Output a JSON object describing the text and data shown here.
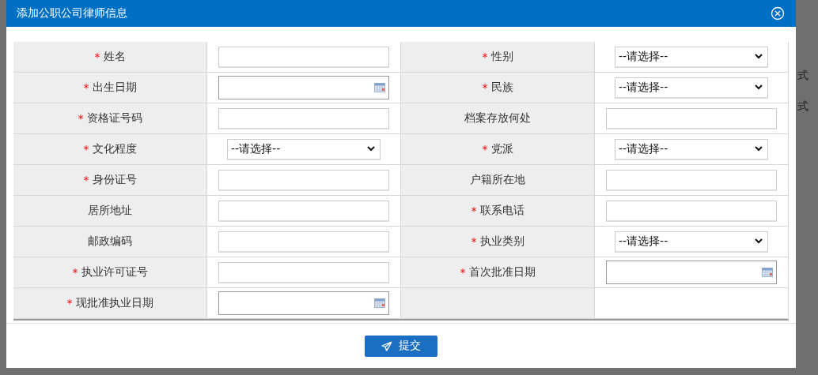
{
  "dialog": {
    "title": "添加公职公司律师信息",
    "submit": "提交"
  },
  "background_cells": [
    "式",
    "式"
  ],
  "rows": [
    [
      {
        "mark": "*",
        "label": "姓名",
        "field": {
          "kind": "text"
        }
      },
      {
        "mark": "*",
        "label": "性别",
        "field": {
          "kind": "select",
          "value": "--请选择--"
        }
      }
    ],
    [
      {
        "mark": "*",
        "label": "出生日期",
        "field": {
          "kind": "date"
        }
      },
      {
        "mark": "*",
        "label": "民族",
        "field": {
          "kind": "select",
          "value": "--请选择--"
        }
      }
    ],
    [
      {
        "mark": "*",
        "label": "资格证号码",
        "field": {
          "kind": "text"
        }
      },
      {
        "label": "档案存放何处",
        "field": {
          "kind": "text"
        }
      }
    ],
    [
      {
        "mark": "*",
        "label": "文化程度",
        "field": {
          "kind": "select",
          "value": "--请选择--"
        }
      },
      {
        "mark": "*",
        "label": "党派",
        "field": {
          "kind": "select",
          "value": "--请选择--"
        }
      }
    ],
    [
      {
        "mark": "*",
        "label": "身份证号",
        "field": {
          "kind": "text"
        }
      },
      {
        "label": "户籍所在地",
        "field": {
          "kind": "text"
        }
      }
    ],
    [
      {
        "label": "居所地址",
        "field": {
          "kind": "text"
        }
      },
      {
        "mark": "*",
        "label": "联系电话",
        "field": {
          "kind": "text"
        }
      }
    ],
    [
      {
        "label": "邮政编码",
        "field": {
          "kind": "text"
        }
      },
      {
        "mark": "*",
        "label": "执业类别",
        "field": {
          "kind": "select",
          "value": "--请选择--"
        }
      }
    ],
    [
      {
        "mark": "*",
        "label": "执业许可证号",
        "field": {
          "kind": "text"
        }
      },
      {
        "mark": "*",
        "label": "首次批准日期",
        "field": {
          "kind": "date"
        }
      }
    ],
    [
      {
        "mark": "*",
        "label": "现批准执业日期",
        "field": {
          "kind": "date"
        }
      },
      {
        "field": {
          "kind": "empty"
        }
      }
    ]
  ]
}
